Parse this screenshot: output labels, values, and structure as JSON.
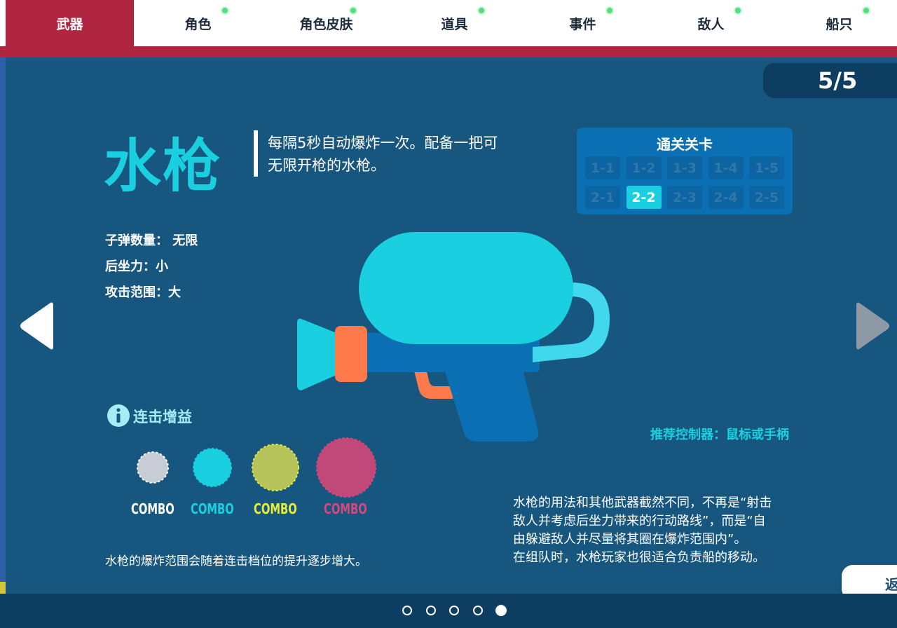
{
  "tabs": [
    {
      "label": "武器",
      "active": true,
      "has_dot": false
    },
    {
      "label": "角色",
      "active": false,
      "has_dot": true
    },
    {
      "label": "角色皮肤",
      "active": false,
      "has_dot": true
    },
    {
      "label": "道具",
      "active": false,
      "has_dot": true
    },
    {
      "label": "事件",
      "active": false,
      "has_dot": true
    },
    {
      "label": "敌人",
      "active": false,
      "has_dot": true
    },
    {
      "label": "船只",
      "active": false,
      "has_dot": true
    }
  ],
  "page_counter": "5/5",
  "weapon": {
    "name": "水枪",
    "description": "每隔5秒自动爆炸一次。配备一把可无限开枪的水枪。",
    "stats": [
      "子弹数量：  无限",
      "后坐力：小",
      "攻击范围：大"
    ]
  },
  "levels": {
    "title": "通关关卡",
    "rows": [
      [
        "1-1",
        "1-2",
        "1-3",
        "1-4",
        "1-5"
      ],
      [
        "2-1",
        "2-2",
        "2-3",
        "2-4",
        "2-5"
      ]
    ],
    "selected": "2-2"
  },
  "combo": {
    "title": "连击增益",
    "items": [
      {
        "label": "COMBO",
        "color": "#c8ccd4",
        "label_color": "#ffffff"
      },
      {
        "label": "COMBO",
        "color": "#19cfe0",
        "label_color": "#19cfe0"
      },
      {
        "label": "COMBO",
        "color": "#b5c35a",
        "label_color": "#e8ec3a"
      },
      {
        "label": "COMBO",
        "color": "#c0497a",
        "label_color": "#d8477c"
      }
    ],
    "description": "水枪的爆炸范围会随着连击档位的提升逐步增大。"
  },
  "controller_recommendation": "推荐控制器：鼠标或手柄",
  "long_description": [
    "水枪的用法和其他武器截然不同，不再是“射击",
    "敌人并考虑后坐力带来的行动路线”，而是“自",
    "由躲避敌人并尽量将其圈在爆炸范围内”。",
    "在组队时，水枪玩家也很适合负责船的移动。"
  ],
  "return_label": "返",
  "pagination": {
    "total": 5,
    "current": 5
  },
  "colors": {
    "background": "#17577f",
    "accent_red": "#b0253f",
    "accent_cyan": "#19cfe0",
    "gun_blue": "#0a6fb3",
    "gun_orange": "#ff7a4a"
  }
}
